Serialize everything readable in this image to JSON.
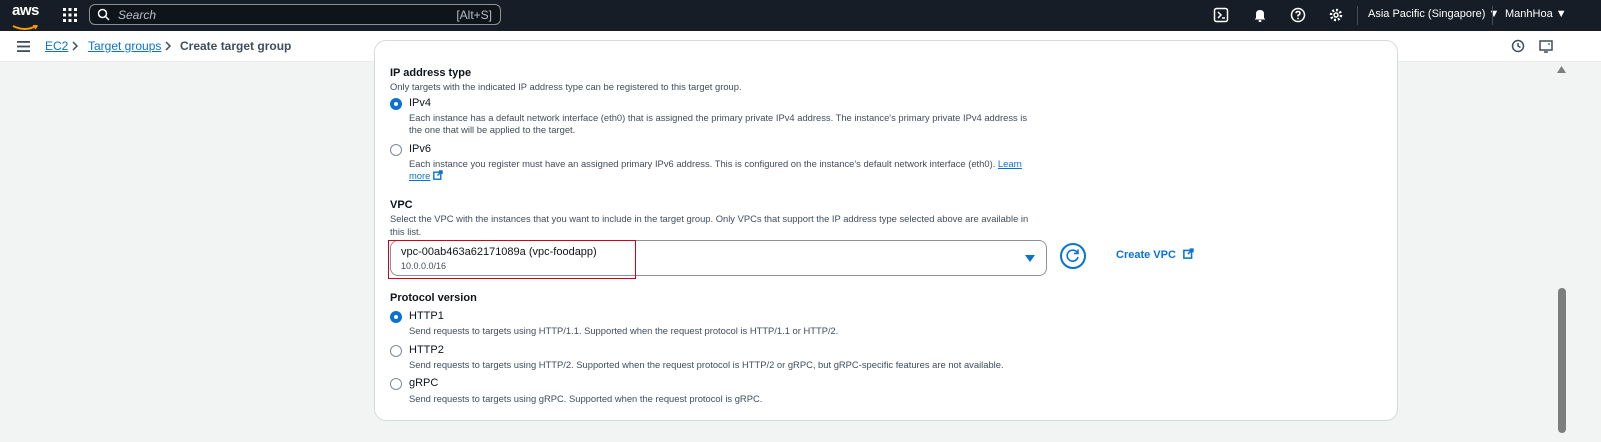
{
  "topbar": {
    "logo": "aws",
    "search_placeholder": "Search",
    "search_shortcut": "[Alt+S]",
    "region": "Asia Pacific (Singapore) ▼",
    "user": "ManhHoa ▼"
  },
  "breadcrumb": {
    "items": [
      "EC2",
      "Target groups",
      "Create target group"
    ]
  },
  "ip_type": {
    "heading": "IP address type",
    "desc": "Only targets with the indicated IP address type can be registered to this target group.",
    "options": [
      {
        "label": "IPv4",
        "desc1": "Each instance has a default network interface (eth0) that is assigned the primary private IPv4 address. The instance's primary private IPv4 address is",
        "desc2": "the one that will be applied to the target.",
        "selected": true
      },
      {
        "label": "IPv6",
        "desc1": "Each instance you register must have an assigned primary IPv6 address. This is configured on the instance's default network interface (eth0).",
        "learn": "Learn",
        "more": "more",
        "selected": false
      }
    ]
  },
  "vpc": {
    "heading": "VPC",
    "desc1": "Select the VPC with the instances that you want to include in the target group. Only VPCs that support the IP address type selected above are available in",
    "desc2": "this list.",
    "selected_value": "vpc-00ab463a62171089a (vpc-foodapp)",
    "selected_cidr": "10.0.0.0/16",
    "create_label": "Create VPC"
  },
  "protocol": {
    "heading": "Protocol version",
    "options": [
      {
        "label": "HTTP1",
        "desc": "Send requests to targets using HTTP/1.1. Supported when the request protocol is HTTP/1.1 or HTTP/2.",
        "selected": true
      },
      {
        "label": "HTTP2",
        "desc": "Send requests to targets using HTTP/2. Supported when the request protocol is HTTP/2 or gRPC, but gRPC-specific features are not available.",
        "selected": false
      },
      {
        "label": "gRPC",
        "desc": "Send requests to targets using gRPC. Supported when the request protocol is gRPC.",
        "selected": false
      }
    ]
  },
  "colors": {
    "accent": "#0972d3",
    "topbar": "#161d26",
    "highlight": "#d0021b"
  }
}
